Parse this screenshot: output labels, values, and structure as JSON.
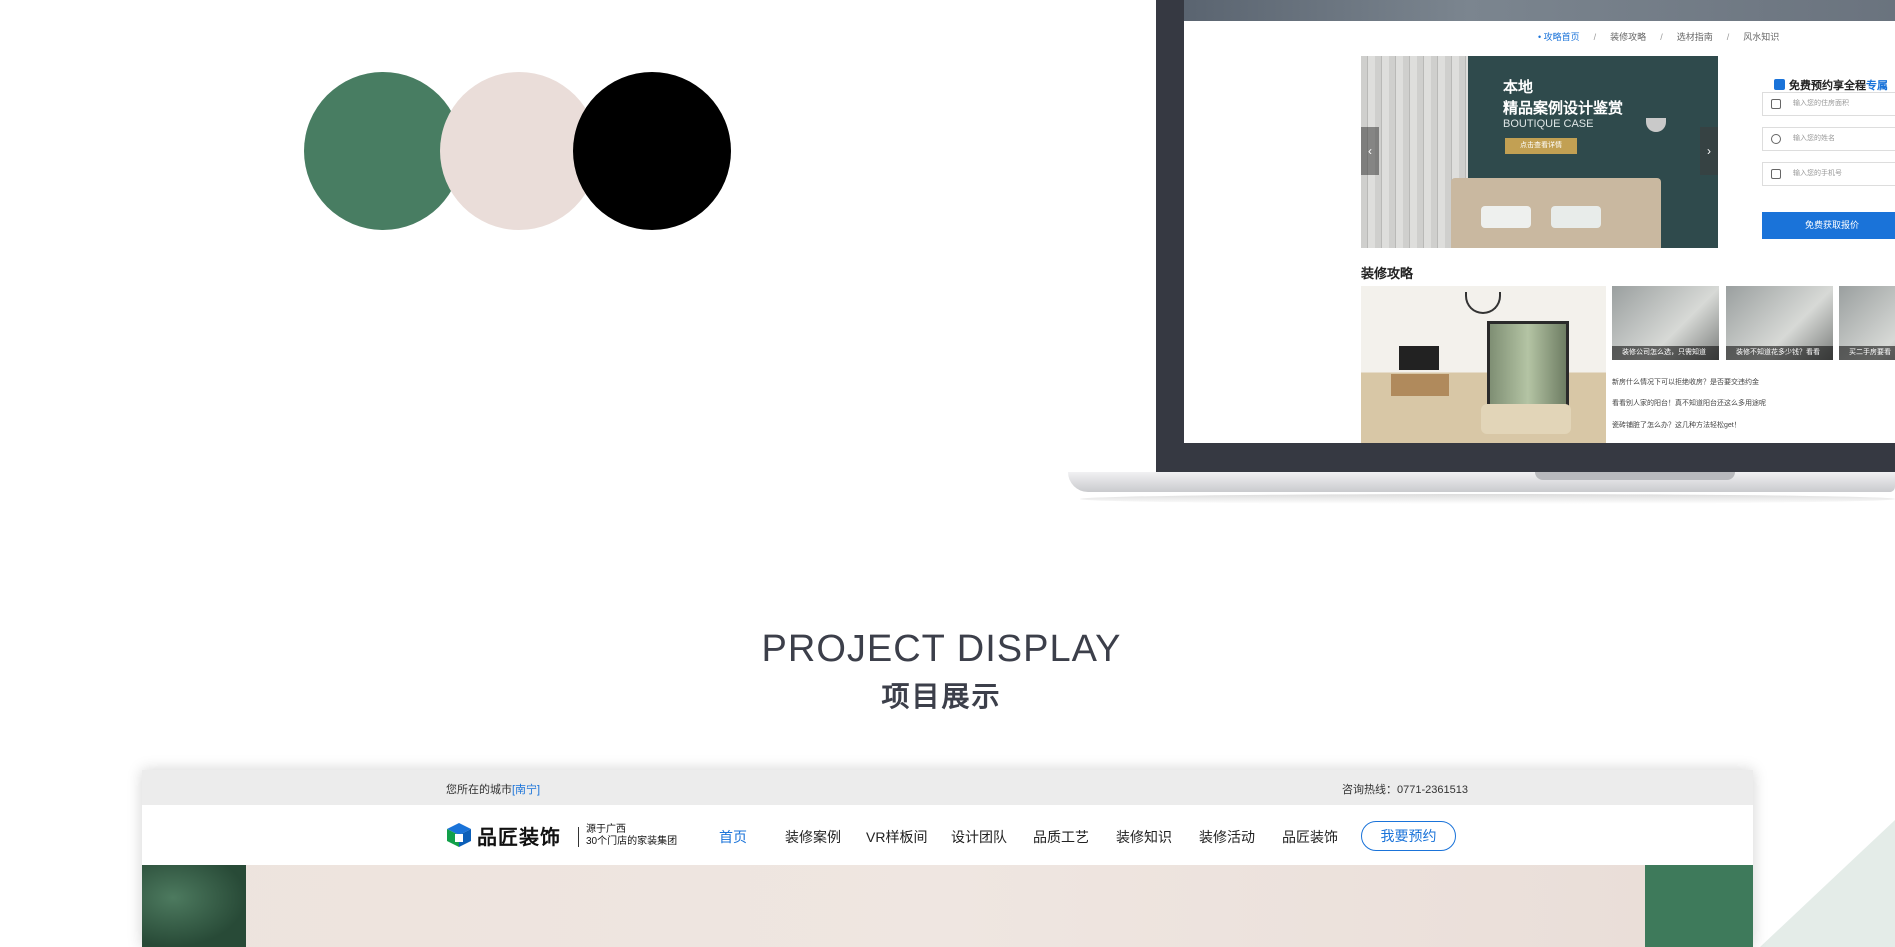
{
  "palette": {
    "colors": [
      "#487d62",
      "#eaddd9",
      "#000000"
    ]
  },
  "laptop": {
    "breadcrumbs": [
      "• 攻略首页",
      "装修攻略",
      "选材指南",
      "风水知识"
    ],
    "banner": {
      "line1": "本地",
      "line2": "精品案例设计鉴赏",
      "line3": "BOUTIQUE CASE",
      "button": "点击查看详情",
      "prev": "‹",
      "next": "›"
    },
    "form": {
      "title_prefix": "免费预约享全程",
      "title_highlight": "专属",
      "fields": [
        "输入您的住房面积",
        "输入您的姓名",
        "输入您的手机号"
      ],
      "submit": "免费获取报价"
    },
    "guides": {
      "title": "装修攻略",
      "thumbs": [
        "装修公司怎么选，只需知道",
        "装修不知道花多少钱？看看",
        "买二手房要看"
      ],
      "list": [
        "新房什么情况下可以拒绝收房？是否要交违约金",
        "看看别人家的阳台！真不知道阳台还这么多用途呢",
        "瓷砖铺脏了怎么办？这几种方法轻松get！"
      ]
    }
  },
  "section": {
    "title_en": "PROJECT DISPLAY",
    "title_cn": "项目展示"
  },
  "site": {
    "city_label": "您所在的城市",
    "city": "[南宁]",
    "hotline": "咨询热线：0771-2361513",
    "logo_name": "品匠装饰",
    "logo_sub1": "源于广西",
    "logo_sub2": "30个门店的家装集团",
    "nav": [
      "首页",
      "装修案例",
      "VR样板间",
      "设计团队",
      "品质工艺",
      "装修知识",
      "装修活动",
      "品匠装饰"
    ],
    "cta": "我要预约",
    "accent": "#1a73d9"
  }
}
